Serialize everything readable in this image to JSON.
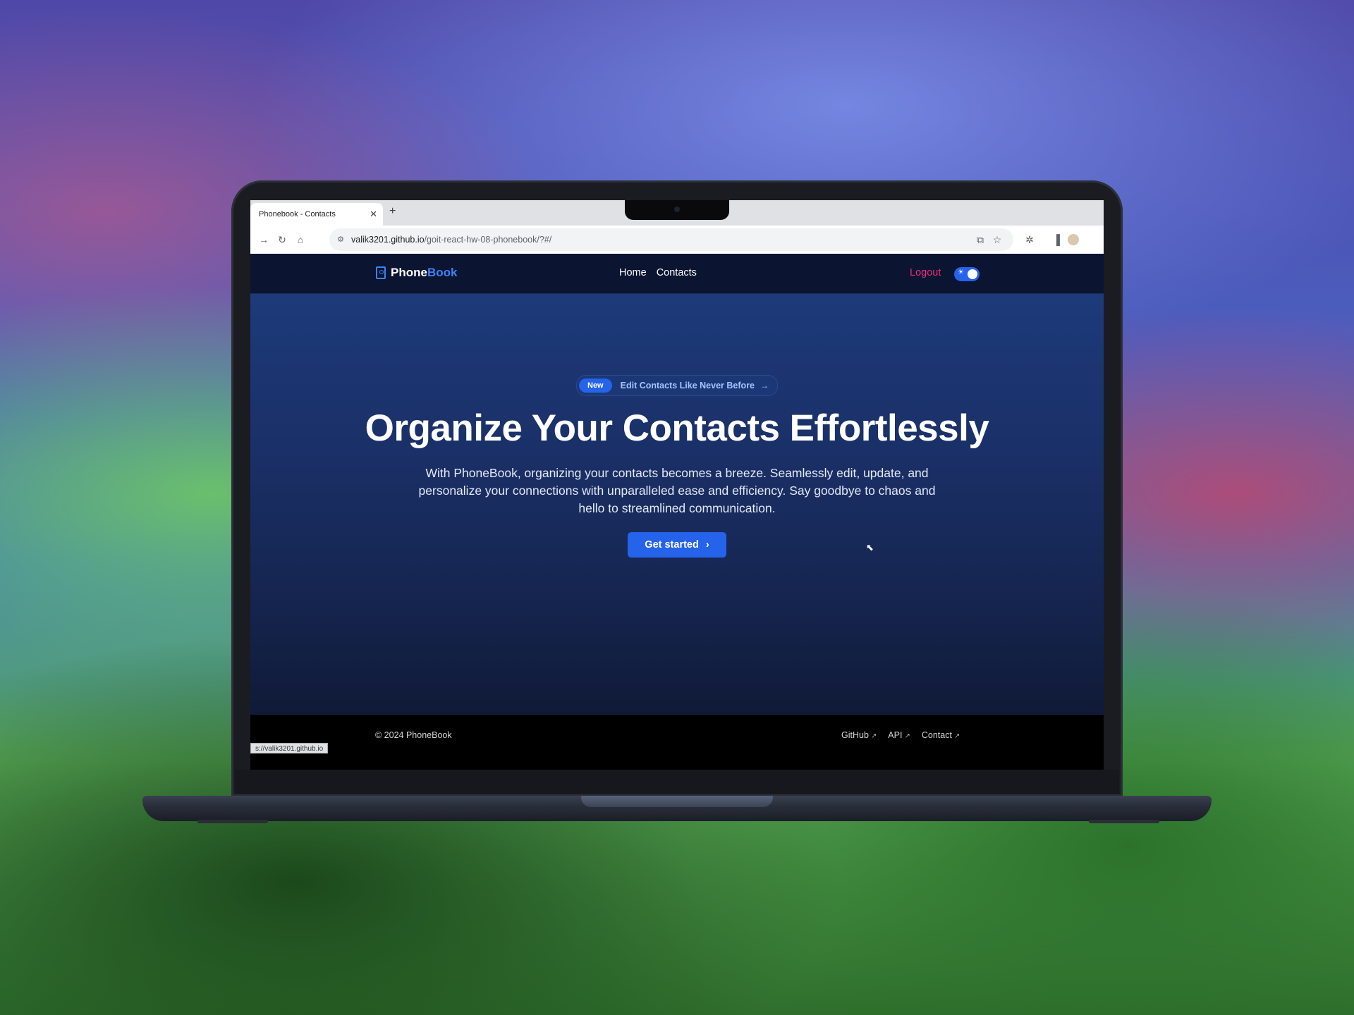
{
  "browser": {
    "tab_title": "Phonebook - Contacts",
    "tab_close": "✕",
    "new_tab": "+",
    "url_host": "valik3201.github.io",
    "url_path": "/goit-react-hw-08-phonebook/?#/",
    "status_url": "s://valik3201.github.io"
  },
  "nav": {
    "logo_part1": "Phone",
    "logo_part2": "Book",
    "links": [
      "Home",
      "Contacts"
    ],
    "logout": "Logout",
    "theme_toggle_on": true
  },
  "hero": {
    "badge_label": "New",
    "badge_text": "Edit Contacts Like Never Before",
    "headline": "Organize Your Contacts Effortlessly",
    "subtitle": "With PhoneBook, organizing your contacts becomes a breeze. Seamlessly edit, update, and personalize your connections with unparalleled ease and efficiency. Say goodbye to chaos and hello to streamlined communication.",
    "cta": "Get started"
  },
  "footer": {
    "copyright": "© 2024 PhoneBook",
    "links": [
      "GitHub",
      "API",
      "Contact"
    ]
  },
  "colors": {
    "accent": "#2563eb",
    "logout": "#ec2d7a",
    "nav_bg": "#0b1430"
  }
}
